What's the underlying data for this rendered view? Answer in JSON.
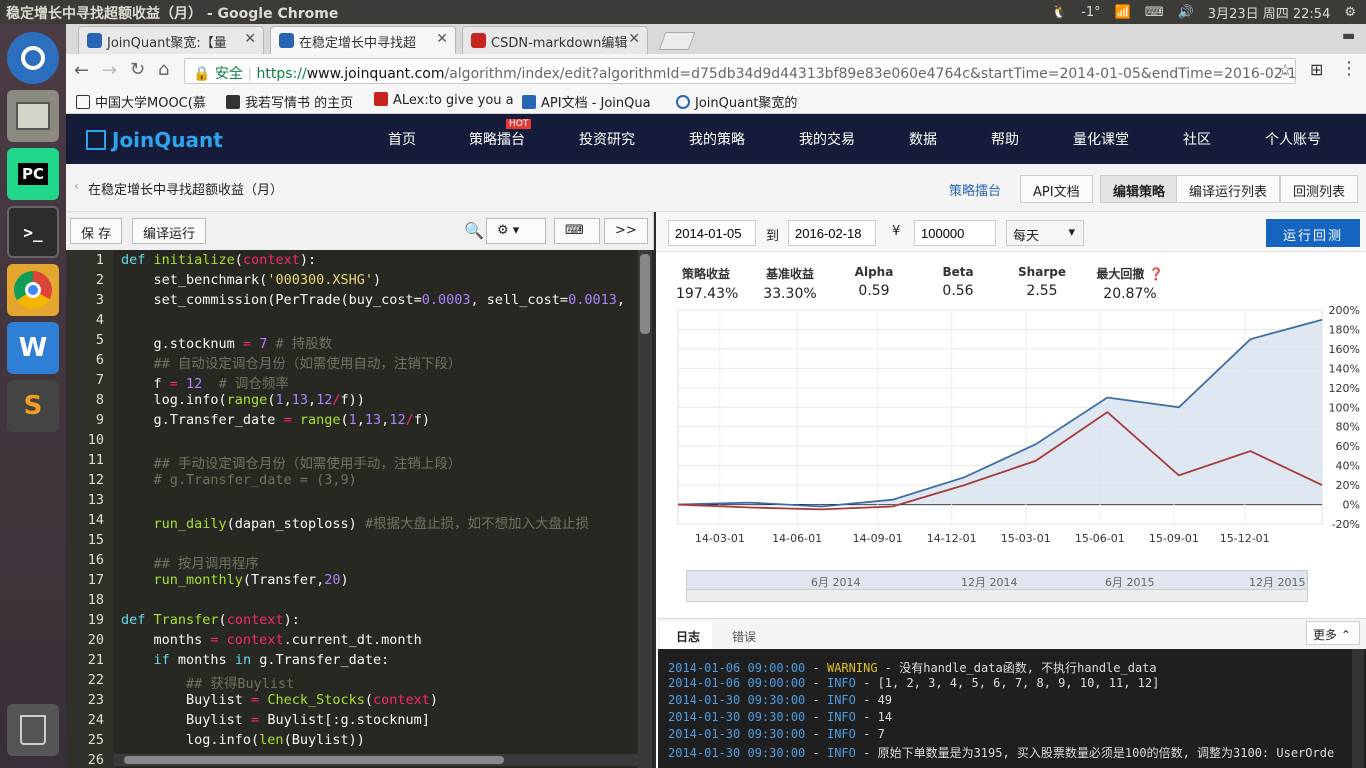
{
  "system_bar": {
    "title": "稳定增长中寻找超额收益（月） - Google Chrome",
    "temperature": "-1°",
    "datetime": "3月23日 周四 22:54"
  },
  "launcher": [
    {
      "name": "ubuntu",
      "label": ""
    },
    {
      "name": "files",
      "label": ""
    },
    {
      "name": "pycharm",
      "label": "PC"
    },
    {
      "name": "terminal",
      "label": ">_"
    },
    {
      "name": "chrome",
      "label": ""
    },
    {
      "name": "wps",
      "label": "W"
    },
    {
      "name": "sublime",
      "label": "S"
    },
    {
      "name": "trash",
      "label": ""
    }
  ],
  "tabs": [
    {
      "label": "JoinQuant聚宽:【量",
      "color": "#2a64b5"
    },
    {
      "label": "在稳定增长中寻找超",
      "color": "#2a64b5"
    },
    {
      "label": "CSDN-markdown编辑",
      "color": "#c7231f"
    }
  ],
  "omnibox": {
    "secure": "安全",
    "url_prefix": "https://",
    "url_host": "www.joinquant.com",
    "url_path": "/algorithm/index/edit?algorithmId=d75db34d9d44313bf89e83e060e4764c&startTime=2014-01-05&endTime=2016-02-18&baseCap"
  },
  "bookmarks": [
    {
      "label": "中国大学MOOC(慕",
      "color": "#333"
    },
    {
      "label": "我若写情书 的主页",
      "color": "#333"
    },
    {
      "label": "ALex:to give you a",
      "color": "#c7231f"
    },
    {
      "label": "API文档 - JoinQua",
      "color": "#2a64b5"
    },
    {
      "label": "JoinQuant聚宽的",
      "color": "#2a64b5"
    }
  ],
  "site": {
    "logo": "JoinQuant",
    "nav": [
      "首页",
      "策略擂台",
      "投资研究",
      "我的策略",
      "我的交易",
      "数据",
      "帮助",
      "量化课堂",
      "社区",
      "个人账号"
    ],
    "hot_badge": "HOT",
    "breadcrumb": "在稳定增长中寻找超额收益（月）",
    "subnav": {
      "arena": "策略擂台",
      "api": "API文档",
      "edit": "编辑策略",
      "compile_list": "编译运行列表",
      "backtest_list": "回测列表"
    }
  },
  "editor": {
    "save": "保 存",
    "compile": "编译运行",
    "expand": ">>",
    "lines": [
      [
        [
          "kw",
          "def "
        ],
        [
          "fn",
          "initialize"
        ],
        [
          "",
          "("
        ],
        [
          "op",
          "context"
        ],
        [
          "",
          "):"
        ]
      ],
      [
        [
          "",
          "    set_benchmark("
        ],
        [
          "st",
          "'000300.XSHG'"
        ],
        [
          "",
          ")"
        ]
      ],
      [
        [
          "",
          "    set_commission(PerTrade(buy_cost="
        ],
        [
          "nu",
          "0.0003"
        ],
        [
          "",
          ", sell_cost="
        ],
        [
          "nu",
          "0.0013"
        ],
        [
          "",
          ","
        ]
      ],
      [],
      [
        [
          "",
          "    g.stocknum "
        ],
        [
          "op",
          "="
        ],
        [
          "nu",
          " 7"
        ],
        [
          "cm",
          " # 持股数"
        ]
      ],
      [
        [
          "cm",
          "    ## 自动设定调仓月份（如需使用自动，注销下段）"
        ]
      ],
      [
        [
          "",
          "    f "
        ],
        [
          "op",
          "="
        ],
        [
          "nu",
          " 12"
        ],
        [
          "cm",
          "  # 调仓频率"
        ]
      ],
      [
        [
          "",
          "    log.info("
        ],
        [
          "fn",
          "range"
        ],
        [
          "",
          "("
        ],
        [
          "nu",
          "1"
        ],
        [
          "",
          ","
        ],
        [
          "nu",
          "13"
        ],
        [
          "",
          ","
        ],
        [
          "nu",
          "12"
        ],
        [
          "op",
          "/"
        ],
        [
          "",
          "f))"
        ]
      ],
      [
        [
          "",
          "    g.Transfer_date "
        ],
        [
          "op",
          "="
        ],
        [
          "fn",
          " range"
        ],
        [
          "",
          "("
        ],
        [
          "nu",
          "1"
        ],
        [
          "",
          ","
        ],
        [
          "nu",
          "13"
        ],
        [
          "",
          ","
        ],
        [
          "nu",
          "12"
        ],
        [
          "op",
          "/"
        ],
        [
          "",
          "f)"
        ]
      ],
      [],
      [
        [
          "cm",
          "    ## 手动设定调仓月份（如需使用手动，注销上段）"
        ]
      ],
      [
        [
          "cm",
          "    # g.Transfer_date = (3,9)"
        ]
      ],
      [],
      [
        [
          "fn",
          "    run_daily"
        ],
        [
          "",
          "(dapan_stoploss) "
        ],
        [
          "cm",
          "#根据大盘止损，如不想加入大盘止损"
        ]
      ],
      [],
      [
        [
          "cm",
          "    ## 按月调用程序"
        ]
      ],
      [
        [
          "fn",
          "    run_monthly"
        ],
        [
          "",
          "(Transfer,"
        ],
        [
          "nu",
          "20"
        ],
        [
          "",
          ")"
        ]
      ],
      [],
      [
        [
          "kw",
          "def "
        ],
        [
          "fn",
          "Transfer"
        ],
        [
          "",
          "("
        ],
        [
          "op",
          "context"
        ],
        [
          "",
          "):"
        ]
      ],
      [
        [
          "",
          "    months "
        ],
        [
          "op",
          "="
        ],
        [
          "op",
          " context"
        ],
        [
          "",
          ".current_dt.month"
        ]
      ],
      [
        [
          "kw",
          "    if "
        ],
        [
          "",
          "months "
        ],
        [
          "kw",
          "in"
        ],
        [
          "",
          " g.Transfer_date:"
        ]
      ],
      [
        [
          "cm",
          "        ## 获得Buylist"
        ]
      ],
      [
        [
          "",
          "        Buylist "
        ],
        [
          "op",
          "="
        ],
        [
          "fn",
          " Check_Stocks"
        ],
        [
          "",
          "("
        ],
        [
          "op",
          "context"
        ],
        [
          "",
          ")"
        ]
      ],
      [
        [
          "",
          "        Buylist "
        ],
        [
          "op",
          "="
        ],
        [
          "",
          " Buylist[:g.stocknum]"
        ]
      ],
      [
        [
          "",
          "        log.info("
        ],
        [
          "fn",
          "len"
        ],
        [
          "",
          "(Buylist))"
        ]
      ],
      []
    ]
  },
  "backtest": {
    "start": "2014-01-05",
    "to": "到",
    "end": "2016-02-18",
    "currency": "¥",
    "capital": "100000",
    "freq": "每天",
    "run": "运行回测",
    "stats": [
      {
        "label": "策略收益",
        "value": "197.43%"
      },
      {
        "label": "基准收益",
        "value": "33.30%"
      },
      {
        "label": "Alpha",
        "value": "0.59"
      },
      {
        "label": "Beta",
        "value": "0.56"
      },
      {
        "label": "Sharpe",
        "value": "2.55"
      },
      {
        "label": "最大回撤",
        "value": "20.87%"
      }
    ],
    "nav_labels": [
      "6月 2014",
      "12月 2014",
      "6月 2015",
      "12月 2015"
    ],
    "log_tab": "日志",
    "error_tab": "错误",
    "more": "更多"
  },
  "chart_data": {
    "type": "line",
    "x": [
      "14-01-05",
      "14-03-01",
      "14-06-01",
      "14-09-01",
      "14-12-01",
      "15-03-01",
      "15-06-01",
      "15-09-01",
      "15-12-01",
      "16-02-18"
    ],
    "xticks": [
      "14-03-01",
      "14-06-01",
      "14-09-01",
      "14-12-01",
      "15-03-01",
      "15-06-01",
      "15-09-01",
      "15-12-01"
    ],
    "yticks": [
      "200%",
      "180%",
      "160%",
      "140%",
      "120%",
      "100%",
      "80%",
      "60%",
      "40%",
      "20%",
      "0%",
      "-20%"
    ],
    "ylim": [
      -20,
      200
    ],
    "series": [
      {
        "name": "",
        "color": "#3b6ea8",
        "values": [
          0,
          2,
          -2,
          5,
          28,
          62,
          110,
          100,
          170,
          190
        ]
      },
      {
        "name": "",
        "color": "#aa3a3a",
        "values": [
          0,
          -3,
          -5,
          -2,
          20,
          45,
          95,
          30,
          55,
          20
        ]
      }
    ]
  },
  "logs": [
    [
      "2014-01-06 09:00:00",
      "WARNING",
      "没有handle_data函数, 不执行handle_data"
    ],
    [
      "2014-01-06 09:00:00",
      "INFO",
      "[1, 2, 3, 4, 5, 6, 7, 8, 9, 10, 11, 12]"
    ],
    [
      "2014-01-30 09:30:00",
      "INFO",
      "49"
    ],
    [
      "2014-01-30 09:30:00",
      "INFO",
      "14"
    ],
    [
      "2014-01-30 09:30:00",
      "INFO",
      "7"
    ],
    [
      "2014-01-30 09:30:00",
      "INFO",
      "原始下单数量是为3195, 买入股票数量必须是100的倍数, 调整为3100: UserOrde"
    ]
  ]
}
